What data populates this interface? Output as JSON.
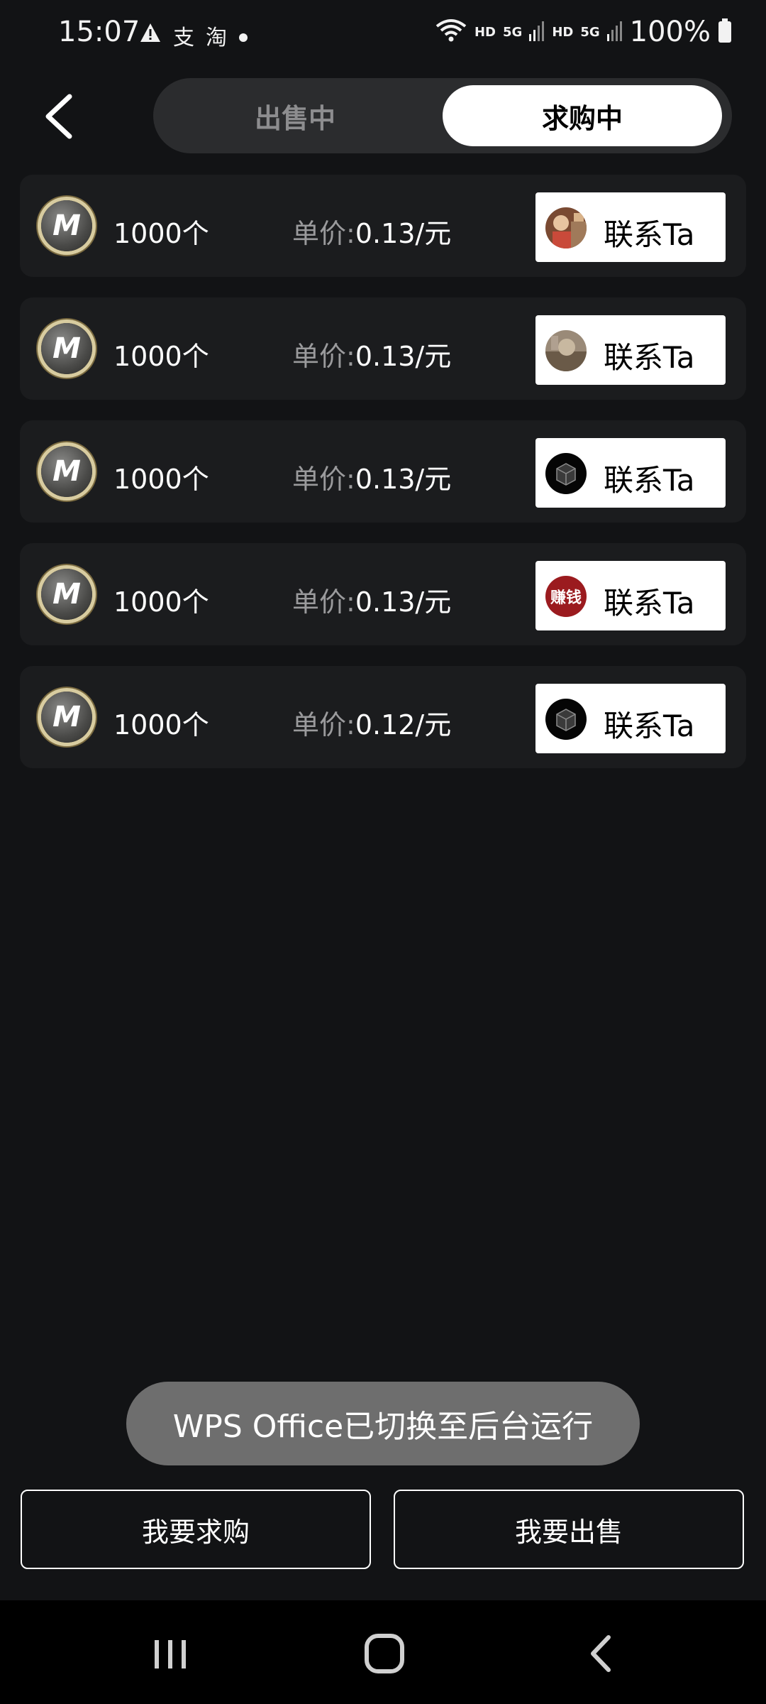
{
  "status_bar": {
    "time": "15:07",
    "left_icons": [
      "warning-icon",
      "alipay-icon",
      "taobao-icon",
      "dot-icon"
    ],
    "app_icon_texts": [
      "支",
      "淘"
    ],
    "network_labels": [
      "HD",
      "5G",
      "HD",
      "5G"
    ],
    "battery_text": "100%"
  },
  "header": {
    "tabs": [
      {
        "label": "出售中",
        "selected": false
      },
      {
        "label": "求购中",
        "selected": true
      }
    ]
  },
  "listings": [
    {
      "coin_letter": "M",
      "quantity": "1000个",
      "price_label": "单价:",
      "price_value": "0.13/元",
      "contact_label": "联系Ta",
      "avatar": "photo-person"
    },
    {
      "coin_letter": "M",
      "quantity": "1000个",
      "price_label": "单价:",
      "price_value": "0.13/元",
      "contact_label": "联系Ta",
      "avatar": "photo-scene"
    },
    {
      "coin_letter": "M",
      "quantity": "1000个",
      "price_label": "单价:",
      "price_value": "0.13/元",
      "contact_label": "联系Ta",
      "avatar": "dark-box"
    },
    {
      "coin_letter": "M",
      "quantity": "1000个",
      "price_label": "单价:",
      "price_value": "0.13/元",
      "contact_label": "联系Ta",
      "avatar": "text-badge",
      "avatar_text": "赚钱"
    },
    {
      "coin_letter": "M",
      "quantity": "1000个",
      "price_label": "单价:",
      "price_value": "0.12/元",
      "contact_label": "联系Ta",
      "avatar": "dark-box"
    }
  ],
  "toast": {
    "text": "WPS Office已切换至后台运行"
  },
  "actions": {
    "buy_label": "我要求购",
    "sell_label": "我要出售"
  },
  "colors": {
    "background": "#121315",
    "row": "#1b1c1e",
    "tab_track": "#2b2c2e",
    "toast": "#6e6e6e",
    "avatar_red": "#9b1b1f"
  }
}
